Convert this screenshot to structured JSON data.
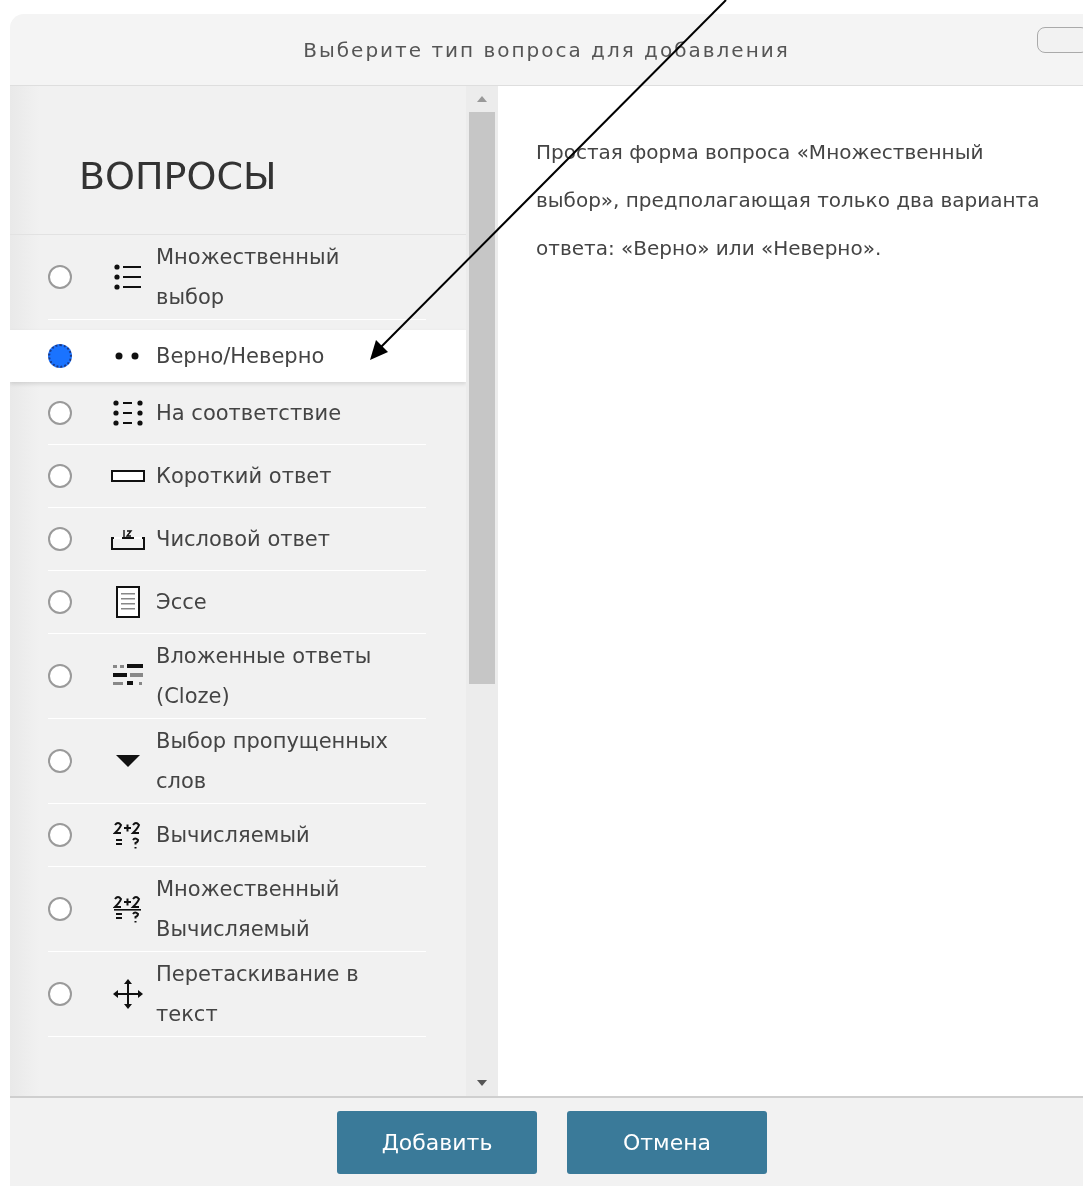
{
  "dialog": {
    "title": "Выберите тип вопроса для добавления"
  },
  "sidebar": {
    "heading": "ВОПРОСЫ",
    "items": [
      {
        "label": "Множественный выбор",
        "kind": "multichoice",
        "selected": false
      },
      {
        "label": "Верно/Неверно",
        "kind": "truefalse",
        "selected": true
      },
      {
        "label": "На соответствие",
        "kind": "match",
        "selected": false
      },
      {
        "label": "Короткий ответ",
        "kind": "shortanswer",
        "selected": false
      },
      {
        "label": "Числовой ответ",
        "kind": "numerical",
        "selected": false
      },
      {
        "label": "Эссе",
        "kind": "essay",
        "selected": false
      },
      {
        "label": "Вложенные ответы (Cloze)",
        "kind": "cloze",
        "selected": false
      },
      {
        "label": "Выбор пропущенных слов",
        "kind": "dropdown",
        "selected": false
      },
      {
        "label": "Вычисляемый",
        "kind": "calculated",
        "selected": false
      },
      {
        "label": "Множественный Вычисляемый",
        "kind": "calcmulti",
        "selected": false
      },
      {
        "label": "Перетаскивание в текст",
        "kind": "dragdrop",
        "selected": false
      }
    ]
  },
  "description": "Простая форма вопроса «Множественный выбор», предполагающая только два варианта ответа: «Верно» или «Неверно».",
  "buttons": [
    "Добавить",
    "Отмена"
  ]
}
